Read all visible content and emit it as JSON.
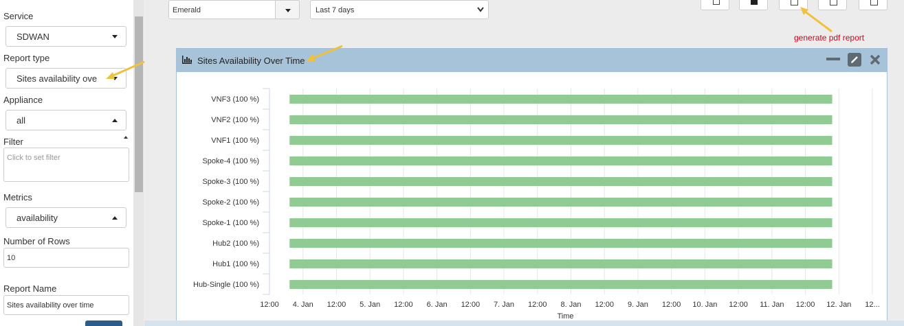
{
  "sidebar": {
    "service": {
      "label": "Service",
      "value": "SDWAN"
    },
    "report_type": {
      "label": "Report type",
      "value": "Sites availability ove"
    },
    "appliance": {
      "label": "Appliance",
      "value": "all"
    },
    "filter": {
      "label": "Filter",
      "placeholder": "Click to set filter"
    },
    "metrics": {
      "label": "Metrics",
      "value": "availability"
    },
    "rows": {
      "label": "Number of Rows",
      "value": "10"
    },
    "report_name": {
      "label": "Report Name",
      "value": "Sites availability over time"
    }
  },
  "toolbar": {
    "tenant": "Emerald",
    "range": "Last 7 days",
    "annotation": "generate pdf report",
    "annotation_color": "#d0021b"
  },
  "panel": {
    "title": "Sites Availability Over Time"
  },
  "chart_data": {
    "type": "bar",
    "orientation": "horizontal",
    "title": "",
    "xlabel": "Time",
    "ylabel": "",
    "categories": [
      "VNF3 (100 %)",
      "VNF2 (100 %)",
      "VNF1 (100 %)",
      "Spoke-4 (100 %)",
      "Spoke-3 (100 %)",
      "Spoke-2 (100 %)",
      "Spoke-1 (100 %)",
      "Hub2 (100 %)",
      "Hub1 (100 %)",
      "Hub-Single (100 %)"
    ],
    "x_ticks": [
      "12:00",
      "4. Jan",
      "12:00",
      "5. Jan",
      "12:00",
      "6. Jan",
      "12:00",
      "7. Jan",
      "12:00",
      "8. Jan",
      "12:00",
      "9. Jan",
      "12:00",
      "10. Jan",
      "12:00",
      "11. Jan",
      "12:00",
      "12. Jan",
      "12..."
    ],
    "x_range_hours": [
      0,
      180
    ],
    "series": [
      {
        "start_hour": 6,
        "end_hour": 168,
        "color": "#8fcb93"
      }
    ],
    "grid": true,
    "bar_color": "#8fcb93"
  }
}
